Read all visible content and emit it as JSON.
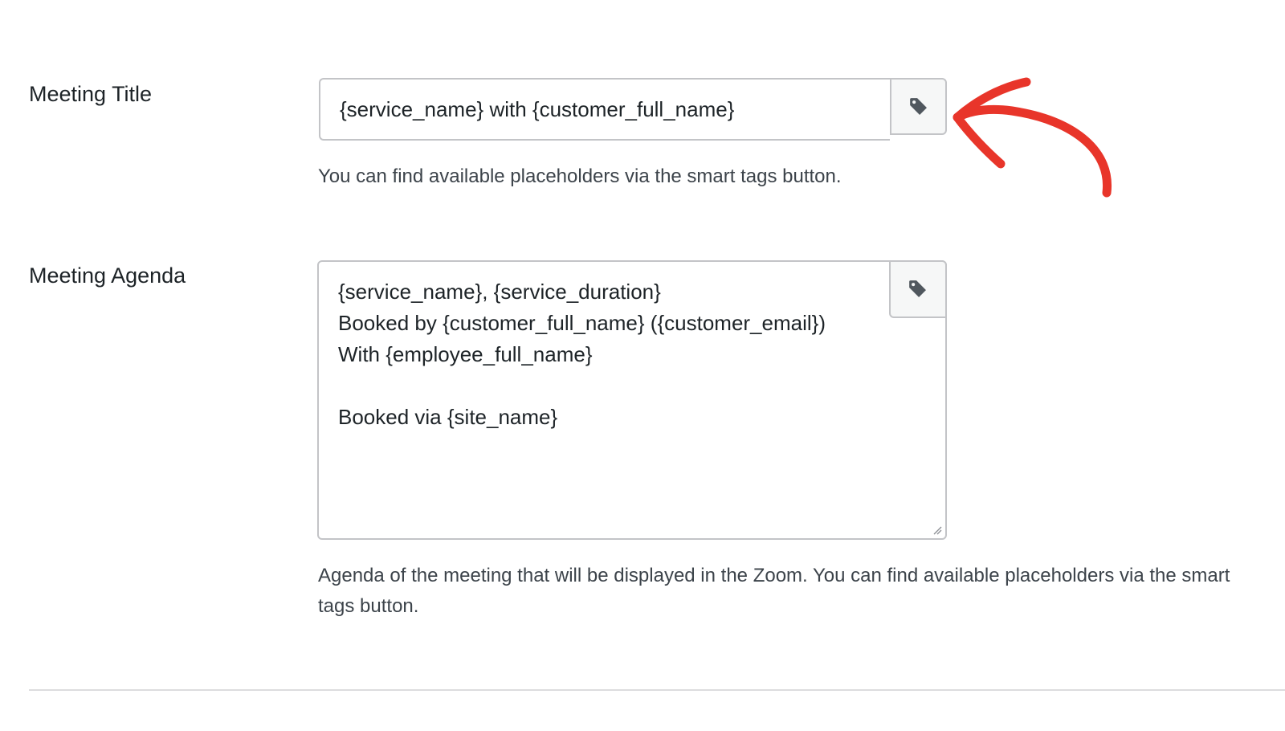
{
  "meeting_title": {
    "label": "Meeting Title",
    "value": "{service_name} with {customer_full_name}",
    "help": "You can find available placeholders via the smart tags button."
  },
  "meeting_agenda": {
    "label": "Meeting Agenda",
    "value": "{service_name}, {service_duration}\nBooked by {customer_full_name} ({customer_email})\nWith {employee_full_name}\n\nBooked via {site_name}",
    "help": "Agenda of the meeting that will be displayed in the Zoom. You can find available placeholders via the smart tags button."
  },
  "icons": {
    "smart_tags": "tag-icon",
    "annotation": "red-arrow-annotation"
  },
  "colors": {
    "arrow": "#e8352a",
    "border": "#c3c4c7",
    "button_bg": "#f6f7f7",
    "icon": "#50575e"
  }
}
